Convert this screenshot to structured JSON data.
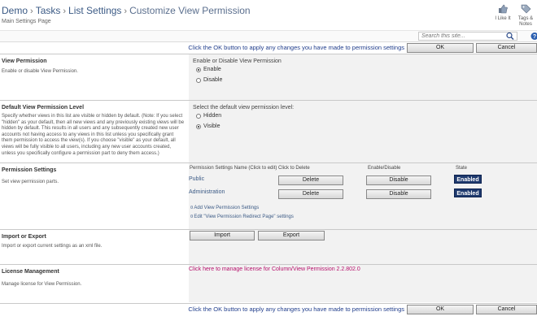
{
  "header": {
    "breadcrumb": [
      "Demo",
      "Tasks",
      "List Settings",
      "Customize View Permission"
    ],
    "separator": "›",
    "subtitle": "Main Settings Page"
  },
  "toolbar": {
    "i_like_it": "I Like It",
    "tags_notes_1": "Tags &",
    "tags_notes_2": "Notes"
  },
  "search": {
    "placeholder": "Search this site..."
  },
  "okbar": {
    "message": "Click the OK button to apply any changes you have made to permission settings",
    "ok_label": "OK",
    "cancel_label": "Cancel"
  },
  "view_permission": {
    "title": "View Permission",
    "description": "Enable or disable View Permission.",
    "field_label": "Enable or Disable View Permission",
    "options": [
      "Enable",
      "Disable"
    ],
    "selected": "Enable"
  },
  "default_level": {
    "title": "Default View Permission Level",
    "description": "Specify whether views in this list are visible or hidden by default. (Note: If you select \"hidden\" as your default, then all new views and any previously existing views will be hidden by default. This results in all users and any subsequently created new user accounts not having access to any views in this list unless you specifically grant them permission to access the view(s). If you choose \"visible\" as your default, all views will be fully visible to all users, including any new user accounts created, unless you specifically configure a permission part to deny them access.)",
    "field_label": "Select the default view permission level:",
    "options": [
      "Hidden",
      "Visible"
    ],
    "selected": "Visible"
  },
  "permission_settings": {
    "title": "Permission Settings",
    "description": "Set view permission parts.",
    "columns": [
      "Permission Settings Name (Click to edit)",
      "Click to Delete",
      "Enable/Disable",
      "State"
    ],
    "rows": [
      {
        "name": "Public",
        "delete_label": "Delete",
        "toggle_label": "Disable",
        "state": "Enabled"
      },
      {
        "name": "Administration",
        "delete_label": "Delete",
        "toggle_label": "Disable",
        "state": "Enabled"
      }
    ],
    "add_link": "Add View Permission Settings",
    "edit_link": "Edit \"View Permission Redirect Page\" settings"
  },
  "import_export": {
    "title": "Import or Export",
    "description": "Import or export current settings as an xml file.",
    "import_label": "Import",
    "export_label": "Export"
  },
  "license": {
    "title": "License Management",
    "description": "Manage license for View Permission.",
    "link": "Click here to manage license for Column/View Permission 2.2.802.0"
  },
  "colors": {
    "link": "#3b5a85",
    "badge": "#1f3a6e",
    "license_link": "#b6106b",
    "ok_message": "#213e8c"
  }
}
